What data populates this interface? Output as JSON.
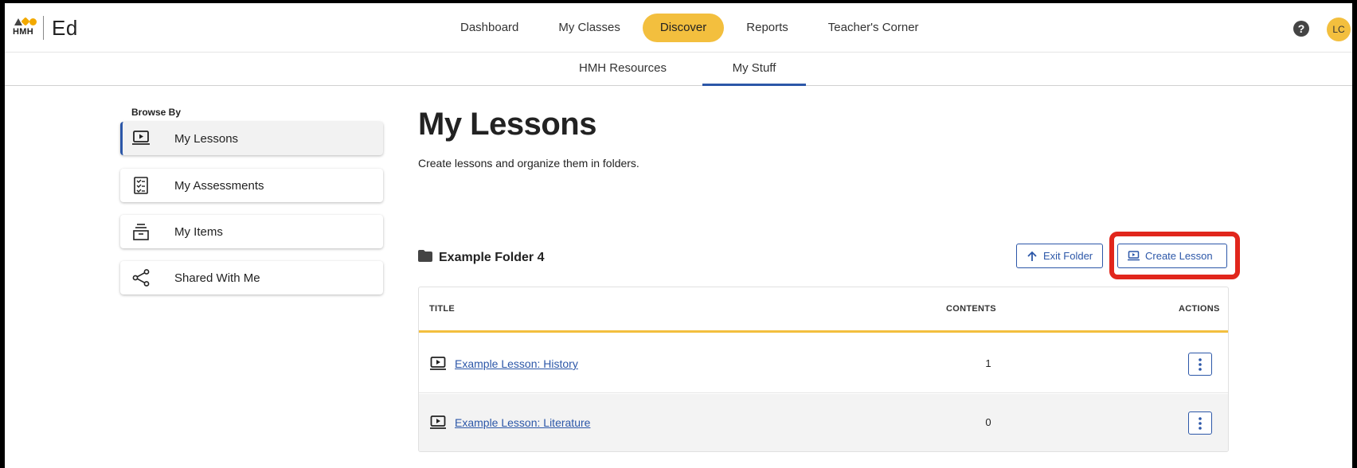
{
  "app": {
    "logo_text": "HMH",
    "product_name": "Ed"
  },
  "topnav": {
    "items": [
      {
        "label": "Dashboard",
        "active": false
      },
      {
        "label": "My Classes",
        "active": false
      },
      {
        "label": "Discover",
        "active": true
      },
      {
        "label": "Reports",
        "active": false
      },
      {
        "label": "Teacher's Corner",
        "active": false
      }
    ],
    "help_icon": "question-circle-icon",
    "avatar_initials": "LC"
  },
  "subnav": {
    "tabs": [
      {
        "label": "HMH Resources",
        "active": false
      },
      {
        "label": "My Stuff",
        "active": true
      }
    ]
  },
  "sidebar": {
    "heading": "Browse By",
    "items": [
      {
        "label": "My Lessons",
        "icon": "lesson-icon",
        "active": true
      },
      {
        "label": "My Assessments",
        "icon": "checklist-icon",
        "active": false
      },
      {
        "label": "My Items",
        "icon": "archive-icon",
        "active": false
      },
      {
        "label": "Shared With Me",
        "icon": "share-icon",
        "active": false
      }
    ]
  },
  "main": {
    "title": "My Lessons",
    "description": "Create lessons and organize them in folders.",
    "folder_name": "Example Folder 4",
    "exit_folder_label": "Exit Folder",
    "create_lesson_label": "Create Lesson"
  },
  "table": {
    "columns": [
      "TITLE",
      "CONTENTS",
      "ACTIONS"
    ],
    "rows": [
      {
        "title": "Example Lesson: History",
        "contents": "1"
      },
      {
        "title": "Example Lesson: Literature",
        "contents": "0"
      }
    ]
  },
  "colors": {
    "accent_blue": "#2c57a8",
    "active_pill": "#f3bf3e",
    "highlight": "#e1261c"
  }
}
